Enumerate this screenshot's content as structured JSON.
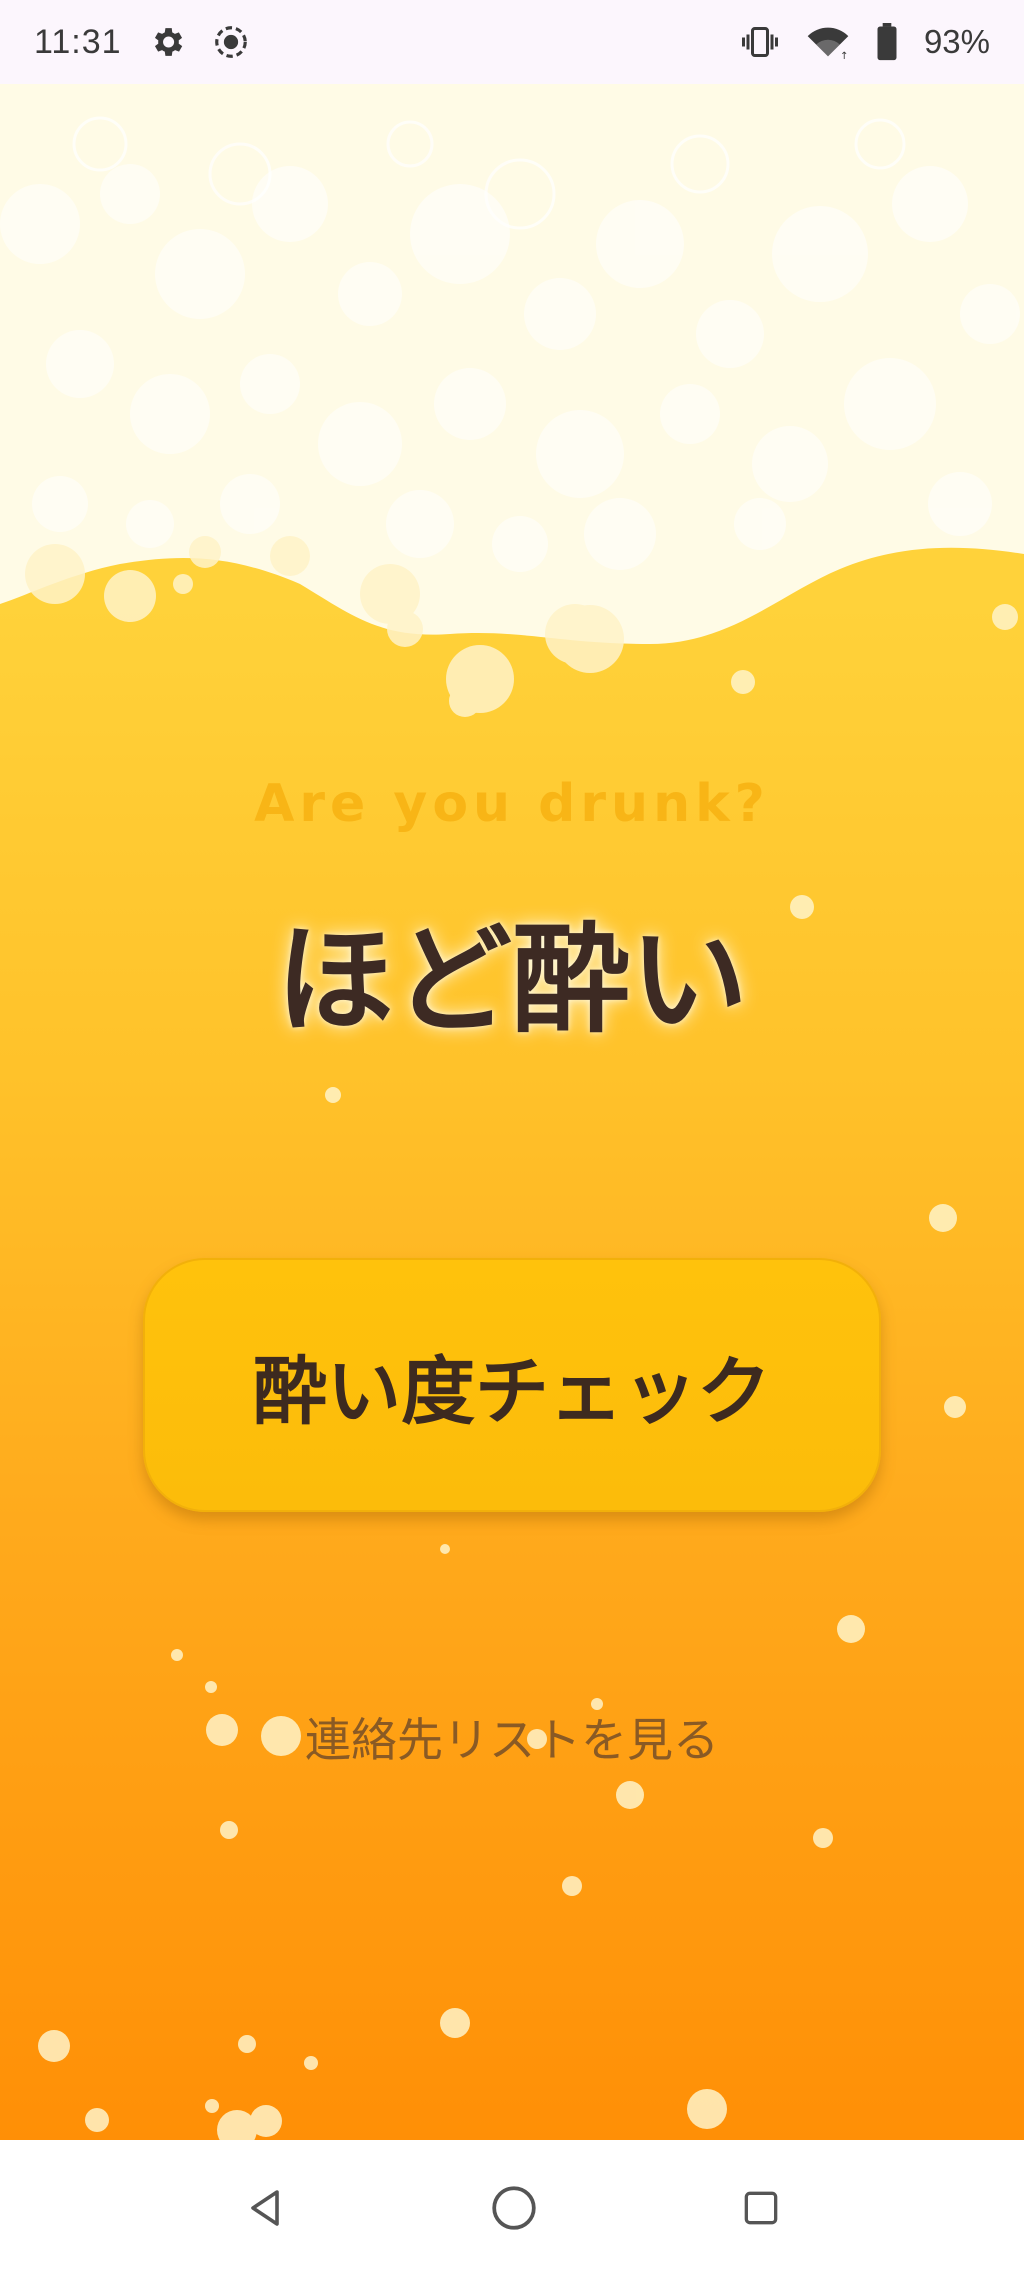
{
  "status_bar": {
    "time": "11:31",
    "left_icons": [
      "gear-icon",
      "screen-record-icon"
    ],
    "right_icons": [
      "vibrate-icon",
      "wifi-icon",
      "battery-icon"
    ],
    "battery_percent": "93%"
  },
  "main": {
    "subtitle": "Are you drunk?",
    "title": "ほど酔い",
    "check_button_label": "酔い度チェック",
    "contacts_link": "連絡先リストを見る"
  },
  "nav_bar": {
    "buttons": [
      "back-icon",
      "home-icon",
      "recents-icon"
    ]
  },
  "colors": {
    "beer_top": "#ffd640",
    "beer_bottom": "#ff8f06",
    "foam": "#fffbe6",
    "button": "#ffc20c",
    "title_text": "#3d2a23",
    "subtitle_text": "#f8b516",
    "link_text": "#8a5a24"
  }
}
